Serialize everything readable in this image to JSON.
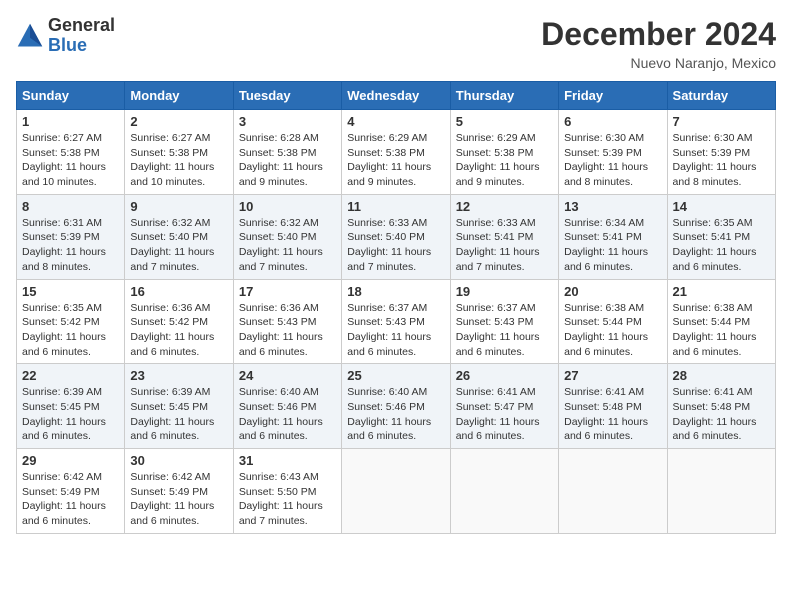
{
  "logo": {
    "general": "General",
    "blue": "Blue"
  },
  "title": "December 2024",
  "location": "Nuevo Naranjo, Mexico",
  "days_header": [
    "Sunday",
    "Monday",
    "Tuesday",
    "Wednesday",
    "Thursday",
    "Friday",
    "Saturday"
  ],
  "weeks": [
    [
      {
        "day": "1",
        "info": "Sunrise: 6:27 AM\nSunset: 5:38 PM\nDaylight: 11 hours\nand 10 minutes."
      },
      {
        "day": "2",
        "info": "Sunrise: 6:27 AM\nSunset: 5:38 PM\nDaylight: 11 hours\nand 10 minutes."
      },
      {
        "day": "3",
        "info": "Sunrise: 6:28 AM\nSunset: 5:38 PM\nDaylight: 11 hours\nand 9 minutes."
      },
      {
        "day": "4",
        "info": "Sunrise: 6:29 AM\nSunset: 5:38 PM\nDaylight: 11 hours\nand 9 minutes."
      },
      {
        "day": "5",
        "info": "Sunrise: 6:29 AM\nSunset: 5:38 PM\nDaylight: 11 hours\nand 9 minutes."
      },
      {
        "day": "6",
        "info": "Sunrise: 6:30 AM\nSunset: 5:39 PM\nDaylight: 11 hours\nand 8 minutes."
      },
      {
        "day": "7",
        "info": "Sunrise: 6:30 AM\nSunset: 5:39 PM\nDaylight: 11 hours\nand 8 minutes."
      }
    ],
    [
      {
        "day": "8",
        "info": "Sunrise: 6:31 AM\nSunset: 5:39 PM\nDaylight: 11 hours\nand 8 minutes."
      },
      {
        "day": "9",
        "info": "Sunrise: 6:32 AM\nSunset: 5:40 PM\nDaylight: 11 hours\nand 7 minutes."
      },
      {
        "day": "10",
        "info": "Sunrise: 6:32 AM\nSunset: 5:40 PM\nDaylight: 11 hours\nand 7 minutes."
      },
      {
        "day": "11",
        "info": "Sunrise: 6:33 AM\nSunset: 5:40 PM\nDaylight: 11 hours\nand 7 minutes."
      },
      {
        "day": "12",
        "info": "Sunrise: 6:33 AM\nSunset: 5:41 PM\nDaylight: 11 hours\nand 7 minutes."
      },
      {
        "day": "13",
        "info": "Sunrise: 6:34 AM\nSunset: 5:41 PM\nDaylight: 11 hours\nand 6 minutes."
      },
      {
        "day": "14",
        "info": "Sunrise: 6:35 AM\nSunset: 5:41 PM\nDaylight: 11 hours\nand 6 minutes."
      }
    ],
    [
      {
        "day": "15",
        "info": "Sunrise: 6:35 AM\nSunset: 5:42 PM\nDaylight: 11 hours\nand 6 minutes."
      },
      {
        "day": "16",
        "info": "Sunrise: 6:36 AM\nSunset: 5:42 PM\nDaylight: 11 hours\nand 6 minutes."
      },
      {
        "day": "17",
        "info": "Sunrise: 6:36 AM\nSunset: 5:43 PM\nDaylight: 11 hours\nand 6 minutes."
      },
      {
        "day": "18",
        "info": "Sunrise: 6:37 AM\nSunset: 5:43 PM\nDaylight: 11 hours\nand 6 minutes."
      },
      {
        "day": "19",
        "info": "Sunrise: 6:37 AM\nSunset: 5:43 PM\nDaylight: 11 hours\nand 6 minutes."
      },
      {
        "day": "20",
        "info": "Sunrise: 6:38 AM\nSunset: 5:44 PM\nDaylight: 11 hours\nand 6 minutes."
      },
      {
        "day": "21",
        "info": "Sunrise: 6:38 AM\nSunset: 5:44 PM\nDaylight: 11 hours\nand 6 minutes."
      }
    ],
    [
      {
        "day": "22",
        "info": "Sunrise: 6:39 AM\nSunset: 5:45 PM\nDaylight: 11 hours\nand 6 minutes."
      },
      {
        "day": "23",
        "info": "Sunrise: 6:39 AM\nSunset: 5:45 PM\nDaylight: 11 hours\nand 6 minutes."
      },
      {
        "day": "24",
        "info": "Sunrise: 6:40 AM\nSunset: 5:46 PM\nDaylight: 11 hours\nand 6 minutes."
      },
      {
        "day": "25",
        "info": "Sunrise: 6:40 AM\nSunset: 5:46 PM\nDaylight: 11 hours\nand 6 minutes."
      },
      {
        "day": "26",
        "info": "Sunrise: 6:41 AM\nSunset: 5:47 PM\nDaylight: 11 hours\nand 6 minutes."
      },
      {
        "day": "27",
        "info": "Sunrise: 6:41 AM\nSunset: 5:48 PM\nDaylight: 11 hours\nand 6 minutes."
      },
      {
        "day": "28",
        "info": "Sunrise: 6:41 AM\nSunset: 5:48 PM\nDaylight: 11 hours\nand 6 minutes."
      }
    ],
    [
      {
        "day": "29",
        "info": "Sunrise: 6:42 AM\nSunset: 5:49 PM\nDaylight: 11 hours\nand 6 minutes."
      },
      {
        "day": "30",
        "info": "Sunrise: 6:42 AM\nSunset: 5:49 PM\nDaylight: 11 hours\nand 6 minutes."
      },
      {
        "day": "31",
        "info": "Sunrise: 6:43 AM\nSunset: 5:50 PM\nDaylight: 11 hours\nand 7 minutes."
      },
      {
        "day": "",
        "info": ""
      },
      {
        "day": "",
        "info": ""
      },
      {
        "day": "",
        "info": ""
      },
      {
        "day": "",
        "info": ""
      }
    ]
  ]
}
